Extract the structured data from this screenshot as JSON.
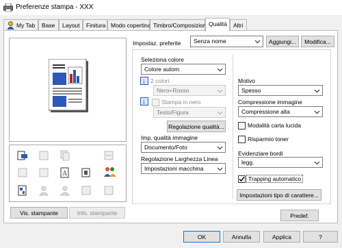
{
  "window": {
    "title": "Preferenze stampa - XXX",
    "icon": "printer-icon"
  },
  "tabs": [
    {
      "label": "My Tab",
      "icon": "mytab-person-icon"
    },
    {
      "label": "Base"
    },
    {
      "label": "Layout"
    },
    {
      "label": "Finitura"
    },
    {
      "label": "Modo copertina"
    },
    {
      "label": "Timbro/Composizione"
    },
    {
      "label": "Qualità",
      "active": true
    },
    {
      "label": "Altri"
    }
  ],
  "preset": {
    "label": "Impostaz. preferite",
    "value": "Senza nome",
    "add_label": "Aggiungi...",
    "modify_label": "Modifica..."
  },
  "left": {
    "printer_view_button": "Vis. stampante",
    "printer_info_button": "Info. stampante"
  },
  "color": {
    "label": "Seleziona colore",
    "value": "Colore autom",
    "two_colors_label": "2 colori",
    "two_colors_value": "Nero+Rosso",
    "black_print_label": "Stampa in nero",
    "black_print_value": "Testo/Figura",
    "adjust_button": "Regolazione qualità..."
  },
  "image_quality": {
    "label": "Imp. qualità immagine",
    "value": "Documento/Foto"
  },
  "line_width": {
    "label": "Regolazione Larghezza Linea",
    "value": "Impostazioni macchina"
  },
  "pattern": {
    "label": "Motivo",
    "value": "Spesso"
  },
  "compression": {
    "label": "Compressione immagine",
    "value": "Compressione alta"
  },
  "glossy": {
    "label": "Modalità carta lucida",
    "checked": false
  },
  "toner_save": {
    "label": "Risparmio toner",
    "checked": false
  },
  "edge": {
    "label": "Evidenziare bordi",
    "value": "legg."
  },
  "trapping": {
    "label": "Trapping automatico",
    "checked": true
  },
  "font_settings_button": "Impostazioni tipo di carattere...",
  "default_button": "Predef.",
  "footer": {
    "ok": "OK",
    "cancel": "Annulla",
    "apply": "Applica",
    "help": "?"
  }
}
